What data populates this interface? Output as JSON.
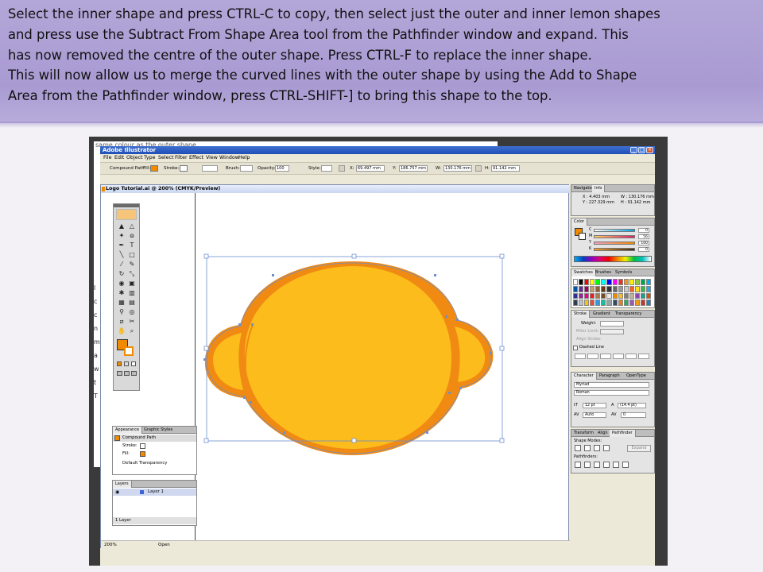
{
  "instructions": {
    "lines": [
      "Select the inner shape and press CTRL-C to copy, then select just the outer and inner lemon shapes",
      "and press use the Subtract From Shape Area tool from the Pathfinder window and expand. This",
      "has now removed the centre of the outer shape. Press CTRL-F to replace the inner shape.",
      "This will now allow us to merge the curved lines with the outer shape by using the Add to Shape",
      "Area from the Pathfinder window, press CTRL-SHIFT-] to bring this shape to the top."
    ]
  },
  "background_window": {
    "title": "same colour as the outer shape",
    "fragments": [
      "l",
      "c",
      "c",
      "n",
      "m",
      "a",
      "w",
      "t",
      "T"
    ]
  },
  "app": {
    "title": "Adobe Illustrator",
    "window_buttons": [
      "_",
      "□",
      "×"
    ],
    "menu": [
      "File",
      "Edit",
      "Object",
      "Type",
      "Select",
      "Filter",
      "Effect",
      "View",
      "Window",
      "Help"
    ],
    "control_bar": {
      "selection_type": "Compound Path",
      "fill_label": "Fill:",
      "stroke_label": "Stroke:",
      "brush_label": "Brush:",
      "opacity_label": "Opacity:",
      "opacity_value": "100",
      "style_label": "Style:",
      "x_label": "X:",
      "x_value": "69.497 mm",
      "y_label": "Y:",
      "y_value": "186.757 mm",
      "w_label": "W:",
      "w_value": "130.176 mm",
      "h_label": "H:",
      "h_value": "91.142 mm"
    },
    "document": {
      "title": "Logo Tutorial.ai @ 200% (CMYK/Preview)",
      "zoom": "200%",
      "status": "Open"
    },
    "appearance_panel": {
      "tabs": [
        "Appearance",
        "Graphic Styles"
      ],
      "object": "Compound Path",
      "stroke_label": "Stroke:",
      "fill_label": "Fill:",
      "transparency": "Default Transparency"
    },
    "layers_panel": {
      "tab": "Layers",
      "layer_name": "Layer 1",
      "count": "1 Layer"
    },
    "info_panel": {
      "tabs": [
        "Navigator",
        "Info"
      ],
      "x": "X : 4.403 mm",
      "y": "Y : 227.329 mm",
      "w": "W : 130.176 mm",
      "h": "H : 91.142 mm"
    },
    "color_panel": {
      "tab": "Color",
      "channels": [
        {
          "label": "C",
          "value": "0"
        },
        {
          "label": "M",
          "value": "56"
        },
        {
          "label": "Y",
          "value": "100"
        },
        {
          "label": "K",
          "value": "0"
        }
      ]
    },
    "swatches_panel": {
      "tabs": [
        "Swatches",
        "Brushes",
        "Symbols"
      ]
    },
    "stroke_panel": {
      "tabs": [
        "Stroke",
        "Gradient",
        "Transparency"
      ],
      "weight_label": "Weight:",
      "miter_label": "Miter Limit:",
      "align_label": "Align Stroke:",
      "dashed_label": "Dashed Line"
    },
    "character_panel": {
      "tabs": [
        "Character",
        "Paragraph",
        "OpenType"
      ],
      "font": "Myriad",
      "style": "Roman",
      "size": "12 pt",
      "leading": "(14.4 pt)",
      "kerning": "Auto",
      "tracking": "0"
    },
    "pathfinder_panel": {
      "tabs": [
        "Transform",
        "Align",
        "Pathfinder"
      ],
      "shape_modes": "Shape Modes:",
      "expand": "Expand",
      "pathfinders": "Pathfinders:"
    }
  },
  "colors": {
    "banner": "#ab9dd3",
    "lemon_outer": "#f08a12",
    "lemon_inner": "#fbbc1c",
    "selection": "#6f8fcf",
    "accent_orange": "#f08a00"
  }
}
